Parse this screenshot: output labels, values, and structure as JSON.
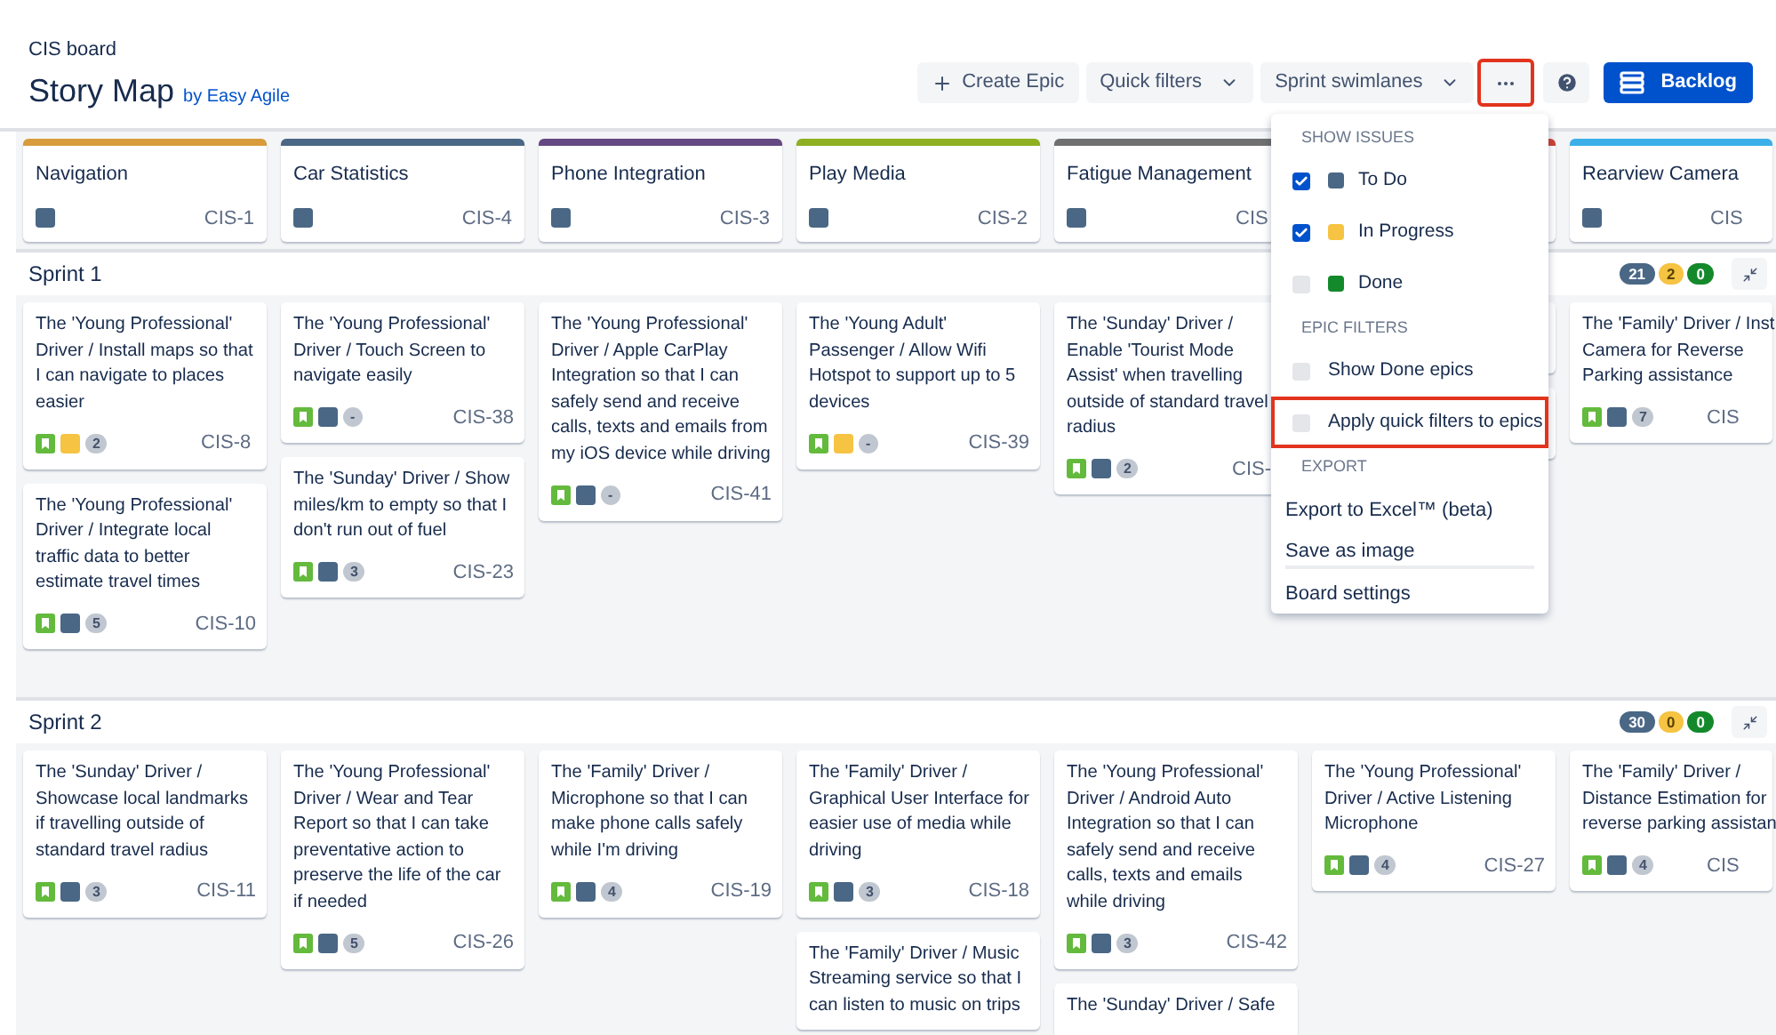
{
  "header": {
    "board": "CIS board",
    "title": "Story Map",
    "byline": "by Easy Agile"
  },
  "toolbar": [
    {
      "kind": "create",
      "label": "Create Epic",
      "highlighted": false
    },
    {
      "kind": "dropdown",
      "label": "Quick filters",
      "highlighted": false
    },
    {
      "kind": "dropdown",
      "label": "Sprint swimlanes",
      "highlighted": false
    },
    {
      "kind": "more",
      "highlighted": true
    },
    {
      "kind": "help",
      "highlighted": false
    },
    {
      "kind": "primary",
      "label": "Backlog",
      "highlighted": false
    }
  ],
  "epics": [
    {
      "title": "Navigation",
      "key": "CIS-1",
      "color": "#d89c3c",
      "status": {
        "color": "#4a6785"
      }
    },
    {
      "title": "Car Statistics",
      "key": "CIS-4",
      "color": "#4a6785",
      "status": {
        "color": "#4a6785"
      }
    },
    {
      "title": "Phone Integration",
      "key": "CIS-3",
      "color": "#654982",
      "status": {
        "color": "#4a6785"
      }
    },
    {
      "title": "Play Media",
      "key": "CIS-2",
      "color": "#8eb021",
      "status": {
        "color": "#4a6785"
      }
    },
    {
      "title": "Fatigue Management",
      "key": "CIS",
      "color": "#707070",
      "status": {
        "color": "#4a6785"
      }
    },
    {
      "color": "#d04437"
    },
    {
      "title": "Rearview Camera",
      "key": "CIS",
      "color": "#3bb0e8",
      "status": {
        "color": "#4a6785"
      }
    }
  ],
  "sprints": [
    {
      "name": "Sprint 1",
      "counts": [
        {
          "value": "21",
          "color": "#4a6785"
        },
        {
          "value": "2",
          "color": "#f6c342"
        },
        {
          "value": "0",
          "color": "#14892c"
        }
      ],
      "columns": [
        [
          {
            "title": "The 'Young Professional' Driver / Install maps so that I can navigate to places easier",
            "status": {
              "color": "#f6c342"
            },
            "estimate": "2",
            "key": "CIS-8"
          },
          {
            "title": "The 'Young Professional' Driver / Integrate local traffic data to better estimate travel times",
            "status": {
              "color": "#4a6785"
            },
            "estimate": "5",
            "key": "CIS-10"
          }
        ],
        [
          {
            "title": "The 'Young Professional' Driver / Touch Screen to navigate easily",
            "status": {
              "color": "#4a6785"
            },
            "estimate": "-",
            "key": "CIS-38"
          },
          {
            "title": "The 'Sunday' Driver / Show miles/km to empty so that I don't run out of fuel",
            "status": {
              "color": "#4a6785"
            },
            "estimate": "3",
            "key": "CIS-23"
          }
        ],
        [
          {
            "title": "The 'Young Professional' Driver / Apple CarPlay Integration so that I can safely send and receive calls, texts and emails from my iOS device while driving",
            "status": {
              "color": "#4a6785"
            },
            "estimate": "-",
            "key": "CIS-41"
          }
        ],
        [
          {
            "title": "The 'Young Adult' Passenger / Allow Wifi Hotspot to support up to 5 devices",
            "status": {
              "color": "#f6c342"
            },
            "estimate": "-",
            "key": "CIS-39"
          }
        ],
        [
          {
            "title": "The 'Sunday' Driver / Enable 'Tourist Mode Assist' when travelling outside of standard travel radius",
            "status": {
              "color": "#4a6785"
            },
            "estimate": "2",
            "key": "CIS-"
          }
        ],
        [
          {},
          {}
        ],
        [
          {
            "title": "The 'Family' Driver / Inst\nCamera for Reverse\nParking assistance",
            "status": {
              "color": "#4a6785"
            },
            "estimate": "7",
            "key": "CIS"
          }
        ]
      ]
    },
    {
      "name": "Sprint 2",
      "counts": [
        {
          "value": "30",
          "color": "#4a6785"
        },
        {
          "value": "0",
          "color": "#f6c342"
        },
        {
          "value": "0",
          "color": "#14892c"
        }
      ],
      "columns": [
        [
          {
            "title": "The 'Sunday' Driver / Showcase local landmarks if travelling outside of standard travel radius",
            "status": {
              "color": "#4a6785"
            },
            "estimate": "3",
            "key": "CIS-11"
          }
        ],
        [
          {
            "title": "The 'Young Professional' Driver / Wear and Tear Report so that I can take preventative action to preserve the life of the car if needed",
            "status": {
              "color": "#4a6785"
            },
            "estimate": "5",
            "key": "CIS-26"
          }
        ],
        [
          {
            "title": "The 'Family' Driver / Microphone so that I can make phone calls safely while I'm driving",
            "status": {
              "color": "#4a6785"
            },
            "estimate": "4",
            "key": "CIS-19"
          }
        ],
        [
          {
            "title": "The 'Family' Driver / Graphical User Interface for easier use of media while driving",
            "status": {
              "color": "#4a6785"
            },
            "estimate": "3",
            "key": "CIS-18"
          },
          {
            "title": "The 'Family' Driver / Music Streaming service so that I can listen to music on trips"
          }
        ],
        [
          {
            "title": "The 'Young Professional' Driver / Android Auto Integration so that I can safely send and receive calls, texts and emails while driving",
            "status": {
              "color": "#4a6785"
            },
            "estimate": "3",
            "key": "CIS-42"
          },
          {
            "title": "The 'Sunday' Driver / Safe"
          }
        ],
        [
          {
            "title": "The 'Young Professional' Driver / Active Listening Microphone",
            "status": {
              "color": "#4a6785"
            },
            "estimate": "4",
            "key": "CIS-27"
          }
        ],
        [
          {
            "title": "The 'Family' Driver /\nDistance Estimation for\nreverse parking assistan",
            "status": {
              "color": "#4a6785"
            },
            "estimate": "4",
            "key": "CIS"
          }
        ]
      ]
    }
  ],
  "menu": [
    {
      "heading": "SHOW ISSUES",
      "items": [
        {
          "kind": "checkbox",
          "label": "To Do",
          "checked": true,
          "color": "#4a6785",
          "highlighted": false
        },
        {
          "kind": "checkbox",
          "label": "In Progress",
          "checked": true,
          "color": "#f6c342",
          "highlighted": false
        },
        {
          "kind": "checkbox",
          "label": "Done",
          "checked": false,
          "color": "#14892c",
          "highlighted": false
        }
      ]
    },
    {
      "heading": "EPIC FILTERS",
      "items": [
        {
          "kind": "checkbox",
          "label": "Show Done epics",
          "checked": false,
          "highlighted": false
        },
        {
          "kind": "checkbox",
          "label": "Apply quick filters to epics",
          "checked": false,
          "highlighted": true
        }
      ]
    },
    {
      "heading": "EXPORT",
      "items": [
        {
          "kind": "action",
          "label": "Export to Excel™ (beta)",
          "separated": false,
          "highlighted": false
        },
        {
          "kind": "action",
          "label": "Save as image",
          "separated": false,
          "highlighted": false
        },
        {
          "kind": "action",
          "label": "Board settings",
          "separated": true,
          "highlighted": false
        }
      ]
    }
  ]
}
